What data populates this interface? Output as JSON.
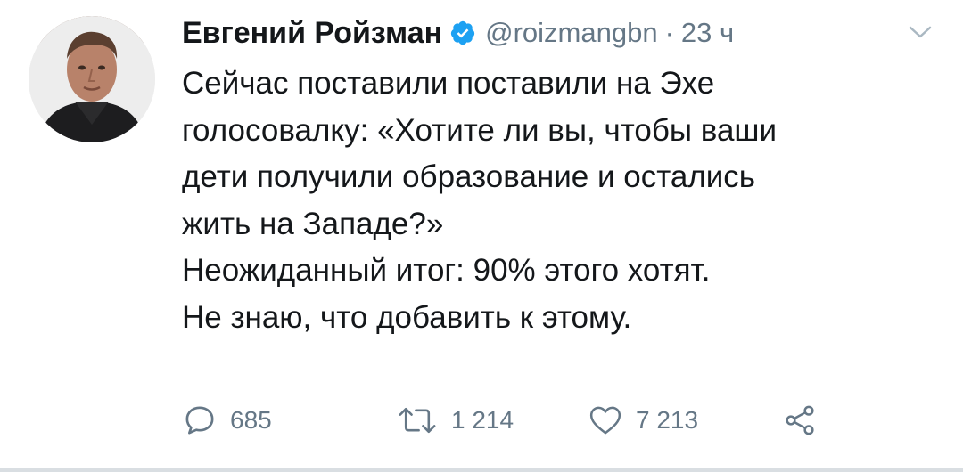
{
  "author": {
    "name": "Евгений Ройзман",
    "handle": "@roizmangbn",
    "separator": "·",
    "time": "23 ч",
    "verified": true
  },
  "tweet": {
    "lines": [
      "Сейчас поставили поставили на Эхе",
      "голосовалку: «Хотите ли вы, чтобы ваши",
      "дети получили образование и остались",
      "жить на Западе?»",
      "Неожиданный итог: 90% этого хотят.",
      "Не знаю, что добавить к этому."
    ]
  },
  "actions": {
    "reply_count": "685",
    "retweet_count": "1 214",
    "like_count": "7 213"
  },
  "icons": {
    "reply": "reply-icon",
    "retweet": "retweet-icon",
    "like": "heart-icon",
    "share": "share-icon",
    "caret": "chevron-down-icon",
    "verified": "verified-badge-icon"
  },
  "colors": {
    "text": "#14171a",
    "secondary": "#657786",
    "verified": "#1da1f2"
  }
}
